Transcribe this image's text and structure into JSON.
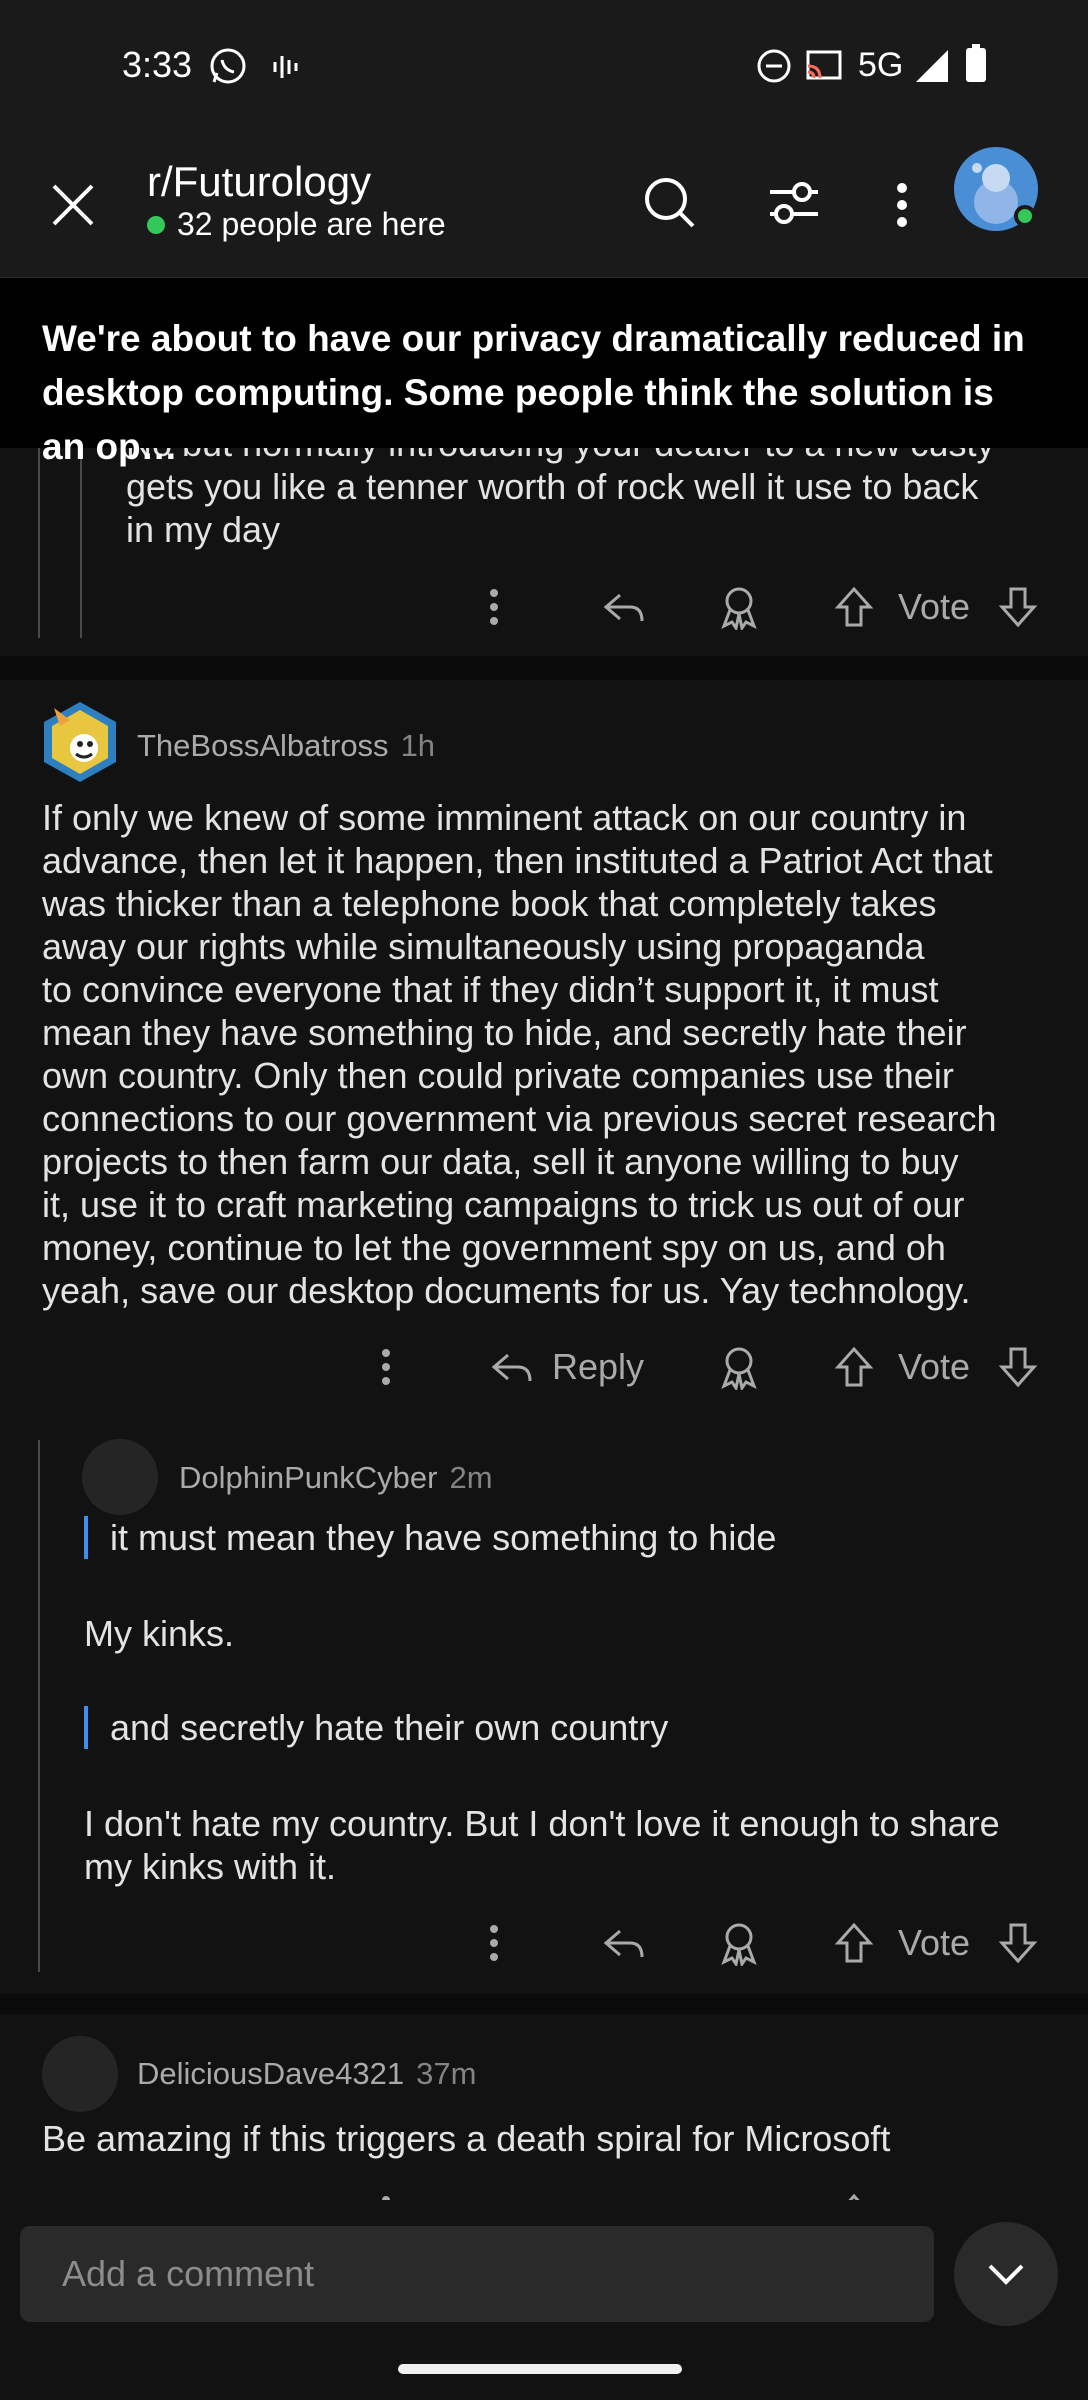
{
  "status_bar": {
    "time": "3:33",
    "network": "5G",
    "icons": [
      "whatsapp-icon",
      "audio-wave-icon",
      "do-not-disturb-icon",
      "cast-icon",
      "signal-icon",
      "battery-icon"
    ]
  },
  "header": {
    "subreddit": "r/Futurology",
    "online_count": "32 people are here",
    "icons": [
      "close-icon",
      "search-icon",
      "filter-icon",
      "more-vertical-icon",
      "avatar"
    ]
  },
  "post": {
    "title": "We're about to have our privacy dramatically reduced in desktop computing. Some people think the solution is an op…"
  },
  "comments": [
    {
      "text_lines": [
        "No but normally introducing your dealer to a new custy",
        "gets you like a tenner worth of rock well it use to back",
        "in my day"
      ]
    },
    {
      "username": "TheBossAlbatross",
      "age": "1h",
      "text_lines": [
        "If only we knew of some imminent attack on our country in",
        "advance, then let it happen, then instituted a Patriot Act that",
        "was thicker than a telephone book that completely takes",
        "away our rights while simultaneously using propaganda",
        "to convince everyone that if they didn’t support it, it must",
        "mean they have something to hide, and secretly hate their",
        "own country. Only then could private companies use their",
        "connections to our government via previous secret research",
        "projects to then farm our data, sell it anyone willing to buy",
        "it, use it to craft marketing campaigns to trick us out of our",
        "money, continue to let the government spy on us, and oh",
        "yeah, save our desktop documents for us. Yay technology."
      ]
    },
    {
      "username": "DolphinPunkCyber",
      "age": "2m",
      "quote1": "it must mean they have something to hide",
      "para1": "My kinks.",
      "quote2": "and secretly hate their own country",
      "para2_lines": [
        "I don't hate my country. But I don't love it enough to share",
        "my kinks with it."
      ]
    },
    {
      "username": "DeliciousDave4321",
      "age": "37m",
      "text": "Be amazing if this triggers a death spiral for Microsoft"
    }
  ],
  "actions": {
    "reply": "Reply",
    "vote": "Vote"
  },
  "composer": {
    "placeholder": "Add a comment"
  },
  "colors": {
    "background": "#121212",
    "header": "#1a1a1b",
    "online": "#34c759",
    "quote_bar": "#3d8ff0"
  }
}
